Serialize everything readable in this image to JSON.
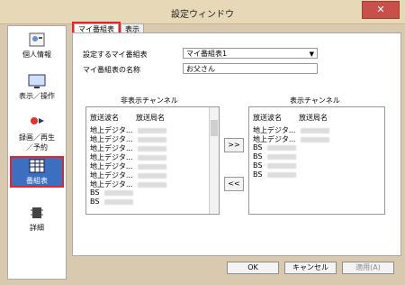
{
  "window": {
    "title": "設定ウィンドウ",
    "close_glyph": "✕"
  },
  "sidebar": {
    "items": [
      {
        "label": "個人情報",
        "icon": "person-card-icon"
      },
      {
        "label": "表示／操作",
        "icon": "display-icon"
      },
      {
        "label": "録画／再生\n／予約",
        "icon": "record-icon"
      },
      {
        "label": "番組表",
        "icon": "program-guide-icon",
        "selected": true
      },
      {
        "label": "詳細",
        "icon": "details-icon"
      }
    ]
  },
  "tabs": [
    {
      "label": "マイ番組表",
      "active": true
    },
    {
      "label": "表示",
      "active": false
    }
  ],
  "form": {
    "select_label": "設定するマイ番組表",
    "select_value": "マイ番組表1",
    "name_label": "マイ番組表の名称",
    "name_value": "お父さん"
  },
  "hidden_channels": {
    "title": "非表示チャンネル",
    "col1": "放送波名",
    "col2": "放送局名",
    "rows": [
      "地上デジタ...",
      "地上デジタ...",
      "地上デジタ...",
      "地上デジタ...",
      "地上デジタ...",
      "地上デジタ...",
      "地上デジタ...",
      "BS",
      "BS"
    ]
  },
  "shown_channels": {
    "title": "表示チャンネル",
    "col1": "放送波名",
    "col2": "放送局名",
    "rows": [
      "地上デジタ...",
      "地上デジタ...",
      "BS",
      "BS",
      "BS",
      "BS"
    ]
  },
  "move_buttons": {
    "right": ">>",
    "left": "<<"
  },
  "buttons": {
    "ok": "OK",
    "cancel": "キャンセル",
    "apply": "適用(A)"
  }
}
